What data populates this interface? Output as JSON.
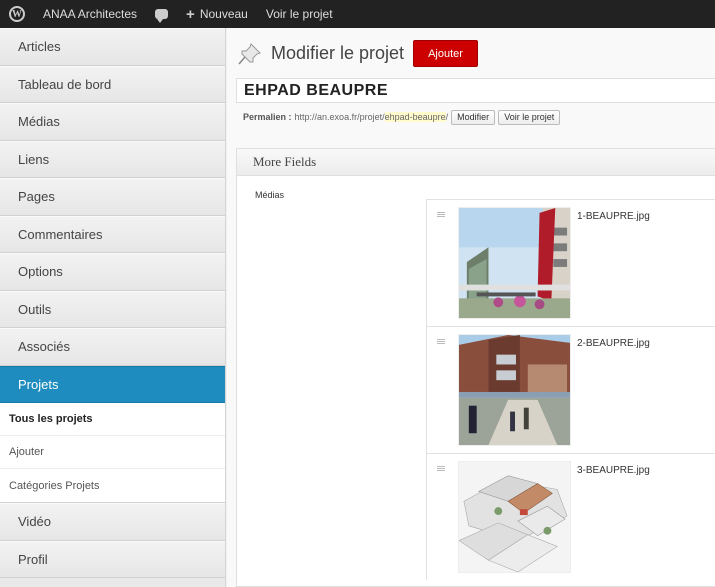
{
  "adminbar": {
    "site_name": "ANAA Architectes",
    "new_label": "Nouveau",
    "view_label": "Voir le projet"
  },
  "sidebar": {
    "items_top": [
      {
        "label": "Articles"
      },
      {
        "label": "Tableau de bord"
      },
      {
        "label": "Médias"
      },
      {
        "label": "Liens"
      },
      {
        "label": "Pages"
      },
      {
        "label": "Commentaires"
      },
      {
        "label": "Options"
      },
      {
        "label": "Outils"
      },
      {
        "label": "Associés"
      }
    ],
    "active": {
      "label": "Projets"
    },
    "submenu": [
      {
        "label": "Tous les projets"
      },
      {
        "label": "Ajouter"
      },
      {
        "label": "Catégories Projets"
      }
    ],
    "items_bottom": [
      {
        "label": "Vidéo"
      },
      {
        "label": "Profil"
      }
    ]
  },
  "main": {
    "page_title": "Modifier le projet",
    "add_button": "Ajouter",
    "post_title": "EHPAD BEAUPRE",
    "permalink": {
      "label": "Permalien :",
      "base": "http://an.exoa.fr/projet/",
      "slug": "ehpad-beaupre",
      "trailing": "/",
      "modify_button": "Modifier",
      "view_button": "Voir le projet"
    },
    "more_fields": {
      "title": "More Fields",
      "medias_label": "Médias",
      "files": [
        {
          "name": "1-BEAUPRE.jpg"
        },
        {
          "name": "2-BEAUPRE.jpg"
        },
        {
          "name": "3-BEAUPRE.jpg"
        }
      ]
    }
  },
  "colors": {
    "adminbar_bg": "#222222",
    "active_menu": "#1e8cbe",
    "add_button": "#cc0000",
    "slug_highlight": "#fffbcc"
  }
}
